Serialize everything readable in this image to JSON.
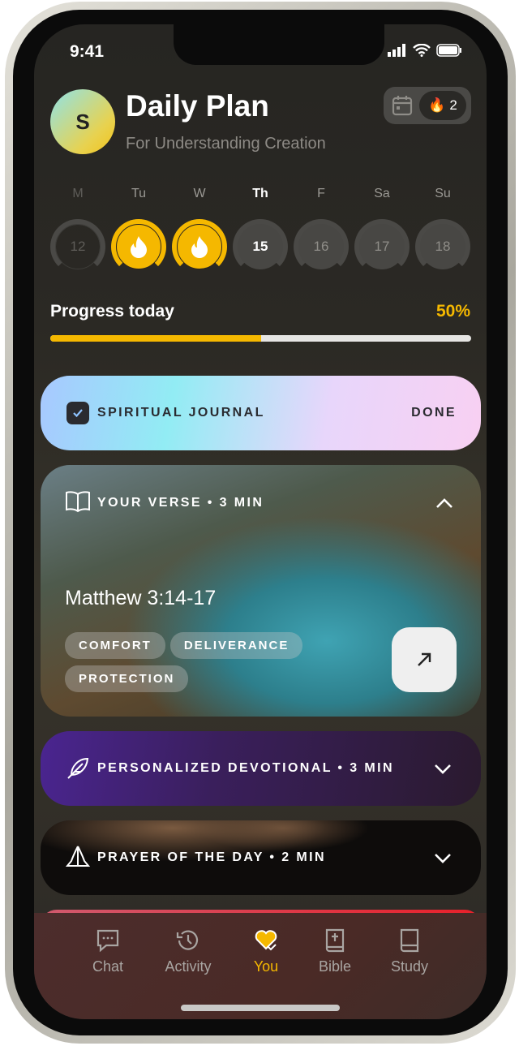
{
  "status_bar": {
    "time": "9:41"
  },
  "header": {
    "avatar_initial": "S",
    "title": "Daily Plan",
    "subtitle": "For Understanding Creation",
    "streak_count": "2"
  },
  "week": [
    {
      "label": "M",
      "date": "12",
      "state": "past"
    },
    {
      "label": "Tu",
      "date": "",
      "state": "done"
    },
    {
      "label": "W",
      "date": "",
      "state": "done"
    },
    {
      "label": "Th",
      "date": "15",
      "state": "today"
    },
    {
      "label": "F",
      "date": "16",
      "state": "future"
    },
    {
      "label": "Sa",
      "date": "17",
      "state": "future"
    },
    {
      "label": "Su",
      "date": "18",
      "state": "future"
    }
  ],
  "progress": {
    "label": "Progress today",
    "value_text": "50%",
    "value": 0.5
  },
  "cards": {
    "journal": {
      "label": "SPIRITUAL JOURNAL",
      "status": "DONE"
    },
    "verse": {
      "label": "YOUR VERSE • 3 MIN",
      "reference": "Matthew 3:14-17",
      "tags": [
        "COMFORT",
        "DELIVERANCE",
        "PROTECTION"
      ]
    },
    "devotional": {
      "label": "PERSONALIZED DEVOTIONAL • 3 MIN"
    },
    "prayer": {
      "label": "PRAYER OF THE DAY • 2 MIN"
    }
  },
  "tabs": [
    {
      "label": "Chat"
    },
    {
      "label": "Activity"
    },
    {
      "label": "You",
      "active": true
    },
    {
      "label": "Bible"
    },
    {
      "label": "Study"
    }
  ],
  "colors": {
    "accent": "#f5b800"
  }
}
